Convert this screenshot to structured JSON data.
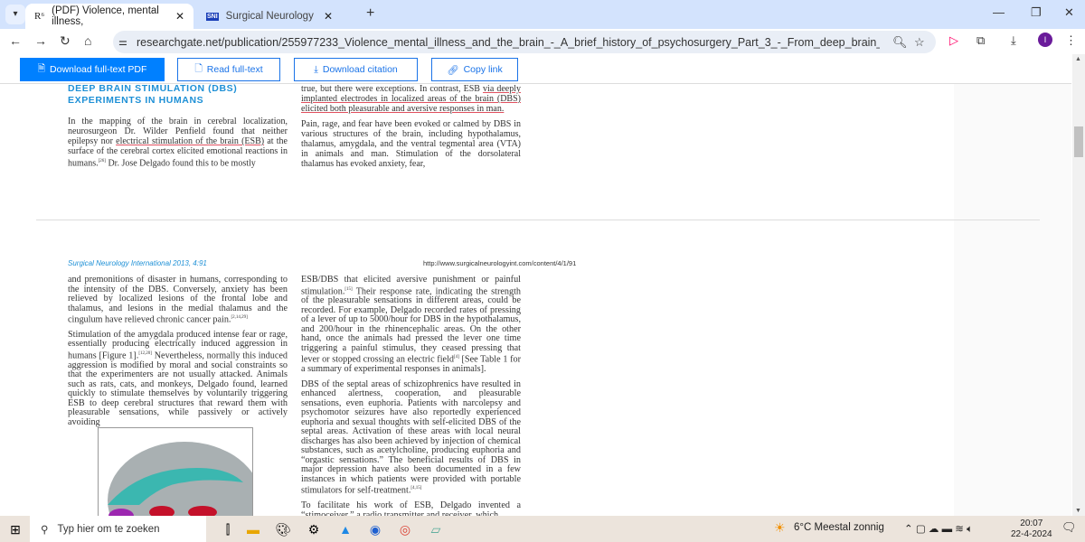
{
  "browser": {
    "tabs": [
      {
        "label": "(PDF) Violence, mental illness,",
        "favicon": "R⁶",
        "active": true
      },
      {
        "label": "Surgical Neurology Internation",
        "favicon": "SNI",
        "active": false
      }
    ],
    "new_tab": "+",
    "url": "researchgate.net/publication/255977233_Violence_mental_illness_and_the_brain_-_A_brief_history_of_psychosurgery_Part_3_-_From_deep_brain_stimulation_to_amygdalot...",
    "profile_initial": "I"
  },
  "actions": {
    "download_pdf": "Download full-text PDF",
    "read": "Read full-text",
    "citation": "Download citation",
    "copy": "Copy link"
  },
  "page1": {
    "heading1": "DEEP BRAIN STIMULATION (DBS)",
    "heading2": "EXPERIMENTS IN HUMANS",
    "left_a": "In the mapping of the brain in cerebral localization, neurosurgeon Dr. Wilder Penfield found that neither epilepsy nor ",
    "left_u": "electrical stimulation of the brain (ESB)",
    "left_b": " at the surface of the cerebral cortex elicited emotional reactions in humans.",
    "left_ref": "[26]",
    "left_c": " Dr. Jose Delgado found this to be mostly",
    "right1_a": "true, but there were exceptions. In contrast, ESB ",
    "right1_u": "via deeply implanted electrodes in localized areas of the brain (DBS) elicited both pleasurable and aversive responses in man.",
    "right2": "Pain, rage, and fear have been evoked or calmed by DBS in various structures of the brain, including hypothalamus, thalamus, amygdala, and the ventral tegmental area (VTA) in animals and man. Stimulation of the dorsolateral thalamus has evoked anxiety, fear,"
  },
  "page2": {
    "journal": "Surgical Neurology International 2013, 4:91",
    "url": "http://www.surgicalneurologyint.com/content/4/1/91",
    "left_p1": "and premonitions of disaster in humans, corresponding to the intensity of the DBS. Conversely, anxiety has been relieved by localized lesions of the frontal lobe and thalamus, and lesions in the medial thalamus and the cingulum have relieved chronic cancer pain.",
    "left_p1_ref": "[2,14,29]",
    "left_p2_a": "Stimulation of the amygdala produced intense fear or rage, essentially producing electrically induced aggression in humans [Figure 1].",
    "left_p2_ref": "[12,20]",
    "left_p2_b": " Nevertheless, normally this induced aggression is modified by moral and social constraints so that the experimenters are not usually attacked. Animals such as rats, cats, and monkeys, Delgado found, learned quickly to stimulate themselves by voluntarily triggering ESB to deep cerebral structures that reward them with pleasurable sensations, while passively or actively avoiding",
    "right_p1_a": "ESB/DBS that elicited aversive punishment or painful stimulation.",
    "right_p1_ref": "[15]",
    "right_p1_b": " Their response rate, indicating the strength of the pleasurable sensations in different areas, could be recorded. For example, Delgado recorded rates of pressing of a lever of up to 5000/hour for DBS in the hypothalamus, and 200/hour in the rhinencephalic areas. On the other hand, once the animals had pressed the lever one time triggering a painful stimulus, they ceased pressing that lever or stopped crossing an electric field",
    "right_p1_ref2": "[4]",
    "right_p1_c": " [See Table 1 for a summary of experimental responses in animals].",
    "right_p2": "DBS of the septal areas of schizophrenics have resulted in enhanced alertness, cooperation, and pleasurable sensations, even euphoria. Patients with narcolepsy and psychomotor seizures have also reportedly experienced euphoria and sexual thoughts with self-elicited DBS of the septal areas. Activation of these areas with local neural discharges has also been achieved by injection of chemical substances, such as acetylcholine, producing euphoria and “orgastic sensations.” The beneficial results of DBS in major depression have also been documented in a few instances in which patients were provided with portable stimulators for self-treatment.",
    "right_p2_ref": "[4,15]",
    "right_p3": "To facilitate his work of ESB, Delgado invented a “stimoceiver,” a radio transmitter and receiver, which"
  },
  "taskbar": {
    "search_placeholder": "Typ hier om te zoeken",
    "weather": "6°C  Meestal zonnig",
    "time": "20:07",
    "date": "22-4-2024"
  }
}
